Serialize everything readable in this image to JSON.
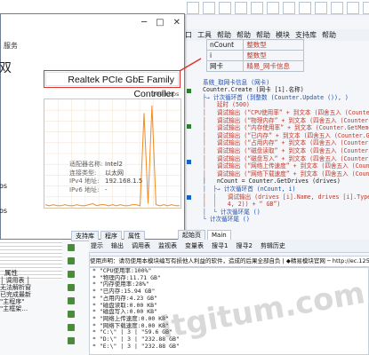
{
  "ide": {
    "menu": [
      "窗口",
      "工具",
      "帮助",
      "T",
      "帮助",
      "H",
      "帮助",
      "模块",
      "支持库",
      "帮助"
    ],
    "var_table": [
      {
        "name": "nCount",
        "type": "整数型"
      },
      {
        "name": "i",
        "type": "整数型"
      },
      {
        "name": "网卡",
        "type": "精易_网卡信息"
      }
    ],
    "code_lines": [
      "系统_取网卡信息 (网卡)",
      "Counter.Create (网卡 [1].名称)",
      "├→ 计次循环首 (到整数 (Counter.Update ()), )",
      "│   延时 (500)",
      "│   调试输出 (“CPU使用率” + 到文本 (四舍五入 (Counter.GetC",
      "│   调试输出 (“物理内存” + 到文本 (四舍五入 (Counter.GetMemory",
      "│   调试输出 (“内存使用率” + 到文本 (Counter.GetMemoryLo",
      "│   调试输出 (“已内存” + 到文本 (四舍五入 (Counter.GetCo",
      "│   调试输出 (“占用内存” + 到文本 (四舍五入 (Counter.GetCo",
      "│   调试输出 (“磁盘读取” + 到文本 (四舍五入 (Counter.GetDi",
      "│   调试输出 (“磁盘写入” + 到文本 (四舍五入 (Counter.GetDi",
      "│   调试输出 (“网络上传速度” + 到文本 (四舍五入 (Counter.Get",
      "│   调试输出 (“网络下载速度” + 到文本 (四舍五入 (Counter.Get",
      "│   nCount = Counter.GetDrives (drives)",
      "│  ├→ 计次循环首 (nCount, i)",
      "│  │   调试输出 (drives [i].Name, drives [i].Type, 到文本 (四",
      "│  │   4, 2)) + “ GB”)",
      "│  └ 计次循环尾 ()",
      "└ 计次循环尾 ()"
    ]
  },
  "network_window": {
    "left_label": "服务",
    "big_label": "双",
    "adapter_name": "Realtek PCIe GbE Family Controller",
    "axis_max": "100 Kbps",
    "left_stats": [
      "os",
      "os"
    ],
    "stats": [
      {
        "k": "适配器名称:",
        "v": "Intel2"
      },
      {
        "k": "连接类型:",
        "v": "以太网"
      },
      {
        "k": "IPv4 地址:",
        "v": "192.168.1.5"
      },
      {
        "k": "IPv6 地址:",
        "v": "-"
      }
    ],
    "chart_data": {
      "type": "line",
      "title": "",
      "xlabel": "",
      "ylabel": "",
      "ylim": [
        0,
        100
      ],
      "y_unit": "Kbps",
      "series": [
        {
          "values": [
            2,
            1,
            2,
            1,
            1,
            2,
            1,
            1,
            2,
            1,
            1,
            2,
            3,
            1,
            2,
            2,
            1,
            2,
            1,
            2,
            1,
            1,
            2,
            2,
            1,
            88,
            3,
            95,
            2,
            1,
            2,
            1,
            2,
            1,
            1
          ]
        }
      ]
    }
  },
  "bottom": {
    "tabs": [
      "支持库",
      "程序",
      "属性"
    ],
    "code_tabs": [
      "起始页",
      "Main"
    ],
    "toolbar": [
      "提示",
      "输出",
      "调用表",
      "监视表",
      "变量表",
      "搜寻1",
      "搜寻2",
      "剪辑历史"
    ],
    "status_text": "使用声明：请勿使用本模块编写有损他人利益的软件，造成的后果全部自负 | ◆精易模块官网  ─  http://ec.125",
    "output_lines": [
      "* \"CPU使用率:100%\"",
      "* \"物理内存:11.71 GB\"",
      "* \"内存使用率:28%\"",
      "* \"已内存:15.94 GB\"",
      "* \"占用内存:4.23 GB\"",
      "* \"磁盘读取:0.00 KB\"",
      "* \"磁盘写入:0.00 KB\"",
      "* \"网络上传速度:0.00 KB\"",
      "* \"网络下载速度:0.00 KB\"",
      "* \"C:\\\" | 3 | \"59.6 GB\"",
      "* \"D:\\\" | 3 | \"232.88 GB\"",
      "* \"E:\\\" | 3 | \"232.88 GB\""
    ],
    "left_prop_label": "属性",
    "left_grid": "│ 调用表 │\n无法解析窗\n已完成最新\n\"主程序\"\n\"主框架…",
    "watermark": "itgitum.com"
  }
}
